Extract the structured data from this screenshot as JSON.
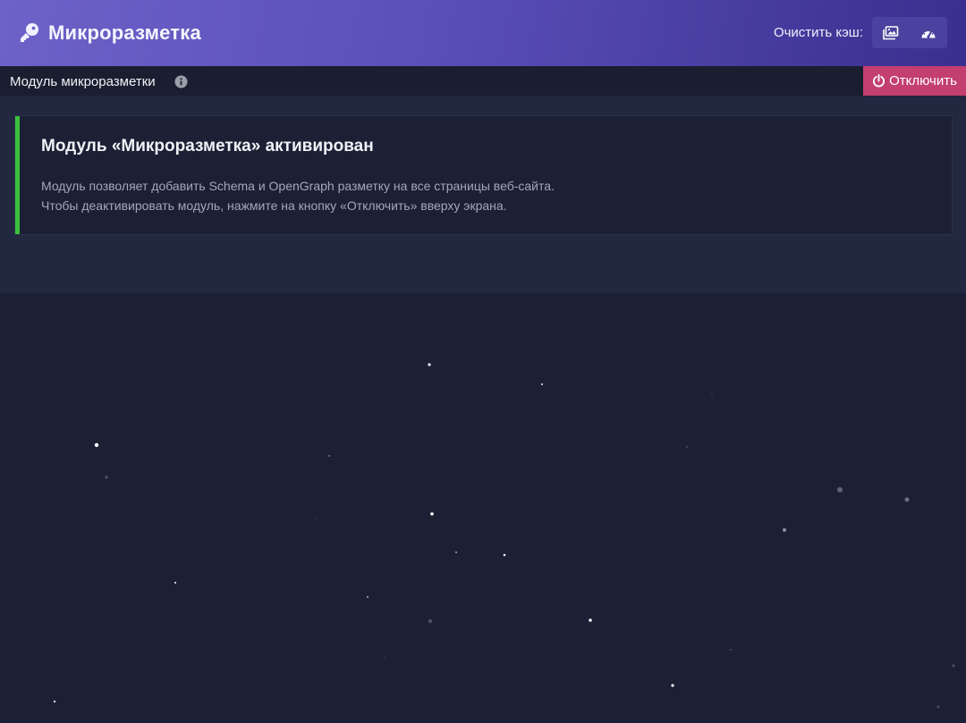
{
  "header": {
    "title": "Микроразметка",
    "cache_label": "Очистить кэш:",
    "icons": {
      "title": "key-icon",
      "cache_images": "images-icon",
      "cache_speed": "gauge-icon"
    },
    "gradient_colors": [
      "#6d62c8",
      "#3a2f8e"
    ]
  },
  "subbar": {
    "module_label": "Модуль микроразметки",
    "info_icon": "info-icon",
    "disable_label": "Отключить",
    "disable_icon": "power-icon",
    "disable_color": "#c23f6f"
  },
  "card": {
    "title": "Модуль «Микроразметка» активирован",
    "lines": [
      "Модуль позволяет добавить Schema и OpenGraph разметку на все страницы веб-сайта.",
      "Чтобы деактивировать модуль, нажмите на кнопку «Отключить» вверху экрана."
    ],
    "accent_color": "#3bc13b"
  },
  "background": {
    "color": "#1c2034"
  }
}
